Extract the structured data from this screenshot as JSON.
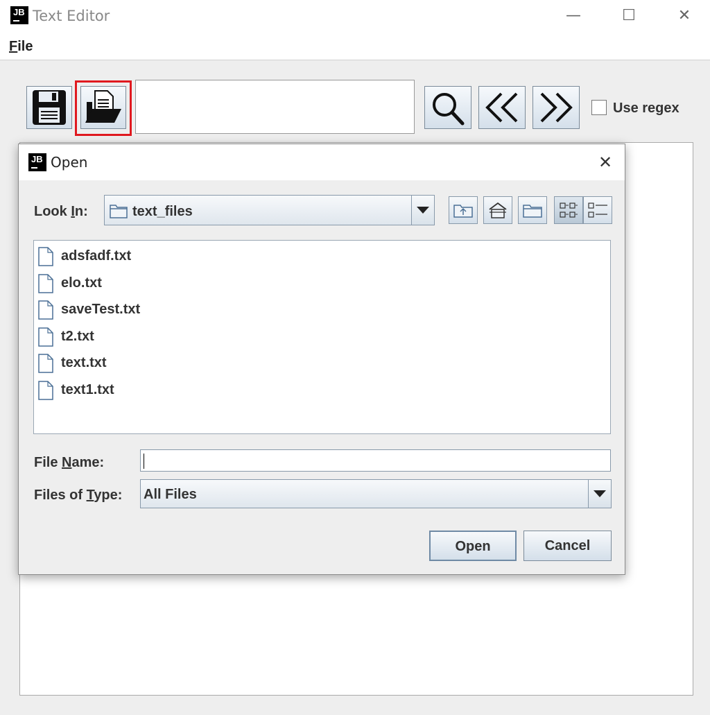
{
  "window": {
    "title": "Text Editor",
    "minimize": "—",
    "maximize": "☐",
    "close": "✕"
  },
  "menubar": {
    "file": {
      "mnemonic": "F",
      "rest": "ile"
    }
  },
  "toolbar": {
    "search_value": "",
    "use_regex_label": "Use regex",
    "use_regex_checked": false,
    "highlight_color": "#e0191f"
  },
  "dialog": {
    "title": "Open",
    "close": "✕",
    "look_in": {
      "before": "Look ",
      "mnemonic": "I",
      "after": "n:"
    },
    "current_folder": "text_files",
    "files": [
      "adsfadf.txt",
      "elo.txt",
      "saveTest.txt",
      "t2.txt",
      "text.txt",
      "text1.txt"
    ],
    "file_name_label": {
      "before": "File ",
      "mnemonic": "N",
      "after": "ame:"
    },
    "file_name_value": "",
    "files_of_type_label": {
      "before": "Files of ",
      "mnemonic": "T",
      "after": "ype:"
    },
    "files_of_type_value": "All Files",
    "open_button": "Open",
    "cancel_button": "Cancel"
  }
}
